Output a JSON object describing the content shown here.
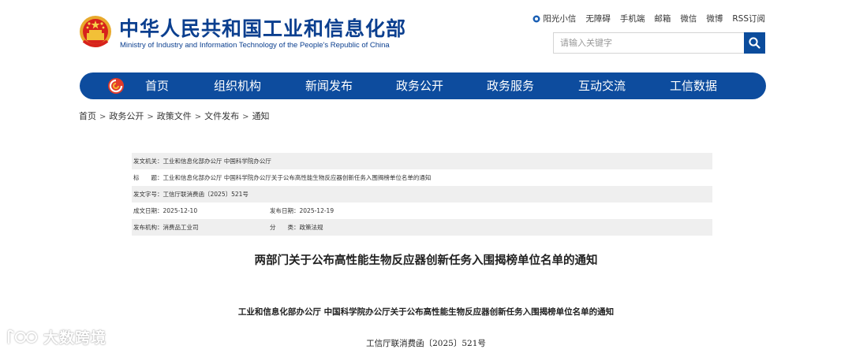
{
  "header": {
    "title_cn": "中华人民共和国工业和信息化部",
    "title_en": "Ministry of Industry and Information Technology of the People's Republic of China",
    "emblem_icon": "national-emblem-icon",
    "brand_color": "#0b3f8f"
  },
  "toplinks": [
    "阳光小信",
    "无障碍",
    "手机端",
    "邮箱",
    "微信",
    "微博",
    "RSS订阅"
  ],
  "search": {
    "placeholder": "请输入关键字",
    "value": "",
    "icon": "search-icon"
  },
  "nav": {
    "color": "#0d4c9e",
    "items": [
      "首页",
      "组织机构",
      "新闻发布",
      "政务公开",
      "政务服务",
      "互动交流",
      "工信数据"
    ]
  },
  "breadcrumb": [
    "首页",
    "政务公开",
    "政策文件",
    "文件发布",
    "通知"
  ],
  "info": {
    "issuer": "发文机关：工业和信息化部办公厅 中国科学院办公厅",
    "title": "标　　题：工业和信息化部办公厅 中国科学院办公厅关于公布高性能生物反应器创新任务入围揭榜单位名单的通知",
    "doc_no": "发文字号：工信厅联消费函〔2025〕521号",
    "written_date": "成文日期：2025-12-10",
    "publish_date": "发布日期：2025-12-19",
    "agency": "发布机构：消费品工业司",
    "category": "分　　类：政策法规"
  },
  "article": {
    "title": "两部门关于公布高性能生物反应器创新任务入围揭榜单位名单的通知",
    "subtitle": "工业和信息化部办公厅  中国科学院办公厅关于公布高性能生物反应器创新任务入围揭榜单位名单的通知",
    "doc_number": "工信厅联消费函〔2025〕521号"
  },
  "watermark": {
    "text": "大数跨境"
  }
}
